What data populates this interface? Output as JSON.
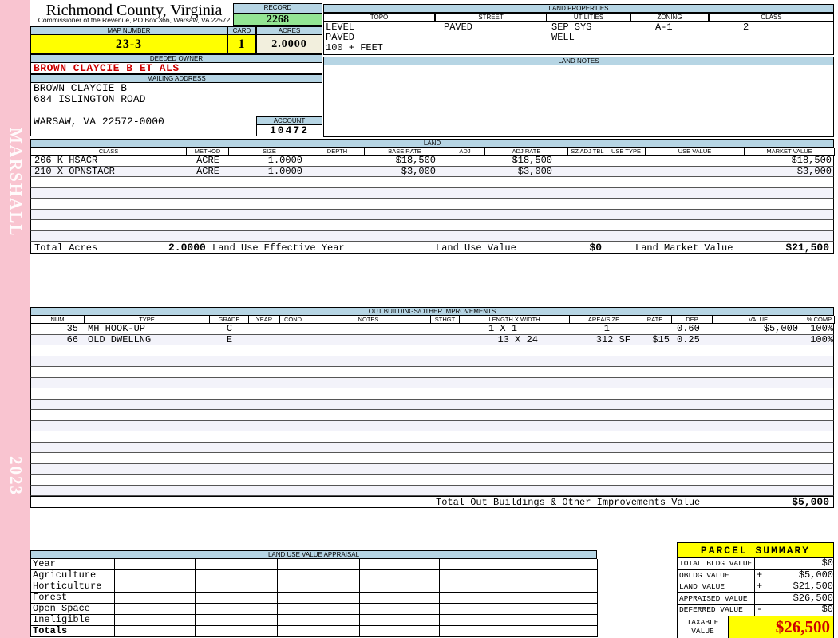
{
  "colors": {
    "spine_pink": "#f9c4d0",
    "header_blue": "#b6d5e4",
    "record_green": "#93e593",
    "highlight_yellow": "#ffff00",
    "acres_cream": "#f2efdd",
    "owner_red": "#cc0000",
    "taxable_red": "#cc0000",
    "alt_row": "#f3f3fa"
  },
  "sidebar": {
    "watermark_top": "MARSHALL",
    "watermark_bottom": "2023"
  },
  "header": {
    "county_title": "Richmond County, Virginia",
    "county_subtitle": "Commissioner of the Revenue, PO Box 366, Warsaw, VA 22572",
    "record_label": "RECORD",
    "record_value": "2268",
    "map_number_label": "MAP NUMBER",
    "map_number_value": "23-3",
    "card_label": "CARD",
    "card_value": "1",
    "acres_label": "ACRES",
    "acres_value": "2.0000"
  },
  "land_properties": {
    "title": "LAND PROPERTIES",
    "columns": [
      "TOPO",
      "STREET",
      "UTILITIES",
      "ZONING",
      "CLASS"
    ],
    "topo": [
      "LEVEL",
      "PAVED",
      "100 + FEET"
    ],
    "street": [
      "PAVED"
    ],
    "utilities": [
      "SEP SYS",
      "WELL"
    ],
    "zoning": [
      "A-1"
    ],
    "class": [
      "2"
    ]
  },
  "owner": {
    "deeded_owner_label": "DEEDED OWNER",
    "deeded_owner": "BROWN CLAYCIE B ET ALS",
    "mailing_address_label": "MAILING ADDRESS",
    "mailing_lines": [
      "BROWN CLAYCIE B",
      "684 ISLINGTON ROAD",
      "",
      "WARSAW, VA 22572-0000"
    ],
    "account_label": "ACCOUNT",
    "account_value": "10472"
  },
  "land_notes": {
    "title": "LAND NOTES",
    "content": ""
  },
  "land": {
    "title": "LAND",
    "columns": [
      "CLASS",
      "METHOD",
      "SIZE",
      "DEPTH",
      "BASE RATE",
      "ADJ",
      "ADJ RATE",
      "SZ ADJ TBL",
      "USE TYPE",
      "USE VALUE",
      "MARKET VALUE"
    ],
    "rows": [
      {
        "class": "206 K HSACR",
        "method": "ACRE",
        "size": "1.0000",
        "depth": "",
        "base_rate": "$18,500",
        "adj": "",
        "adj_rate": "$18,500",
        "sz_adj_tbl": "",
        "use_type": "",
        "use_value": "",
        "market_value": "$18,500"
      },
      {
        "class": "210 X OPNSTACR",
        "method": "ACRE",
        "size": "1.0000",
        "depth": "",
        "base_rate": "$3,000",
        "adj": "",
        "adj_rate": "$3,000",
        "sz_adj_tbl": "",
        "use_type": "",
        "use_value": "",
        "market_value": "$3,000"
      }
    ],
    "totals": {
      "total_acres_label": "Total Acres",
      "total_acres_value": "2.0000",
      "effective_year_label": "Land Use Effective Year",
      "effective_year_value": "",
      "land_use_value_label": "Land Use Value",
      "land_use_value": "$0",
      "land_market_value_label": "Land Market Value",
      "land_market_value": "$21,500"
    }
  },
  "out_buildings": {
    "title": "OUT BUILDINGS/OTHER IMPROVEMENTS",
    "columns": [
      "NUM",
      "TYPE",
      "GRADE",
      "YEAR",
      "COND",
      "NOTES",
      "STHGT",
      "LENGTH X WIDTH",
      "AREA/SIZE",
      "RATE",
      "DEP",
      "VALUE",
      "% COMP"
    ],
    "rows": [
      {
        "num": "35",
        "type": "MH HOOK-UP",
        "grade": "C",
        "year": "",
        "cond": "",
        "notes": "",
        "sthgt": "",
        "length_width": "1 X 1",
        "area_size": "1",
        "rate": "",
        "dep": "0.60",
        "value": "$5,000",
        "comp": "100%"
      },
      {
        "num": "66",
        "type": "OLD DWELLNG",
        "grade": "E",
        "year": "",
        "cond": "",
        "notes": "",
        "sthgt": "",
        "length_width": "13 X 24",
        "area_size": "312 SF",
        "rate": "$15",
        "dep": "0.25",
        "value": "",
        "comp": "100%"
      }
    ],
    "total_label": "Total Out Buildings & Other Improvements Value",
    "total_value": "$5,000"
  },
  "land_use_appraisal": {
    "title": "LAND USE VALUE APPRAISAL",
    "row_labels": [
      "Year",
      "Agriculture",
      "Horticulture",
      "Forest",
      "Open Space",
      "Ineligible",
      "Totals"
    ]
  },
  "parcel_summary": {
    "title": "PARCEL SUMMARY",
    "rows": [
      {
        "label": "TOTAL BLDG VALUE",
        "op": "",
        "value": "$0"
      },
      {
        "label": "OBLDG VALUE",
        "op": "+",
        "value": "$5,000"
      },
      {
        "label": "LAND VALUE",
        "op": "+",
        "value": "$21,500"
      },
      {
        "label": "APPRAISED VALUE",
        "op": "",
        "value": "$26,500"
      },
      {
        "label": "DEFERRED VALUE",
        "op": "-",
        "value": "$0"
      }
    ],
    "taxable_label": "TAXABLE\nVALUE",
    "taxable_value": "$26,500"
  }
}
